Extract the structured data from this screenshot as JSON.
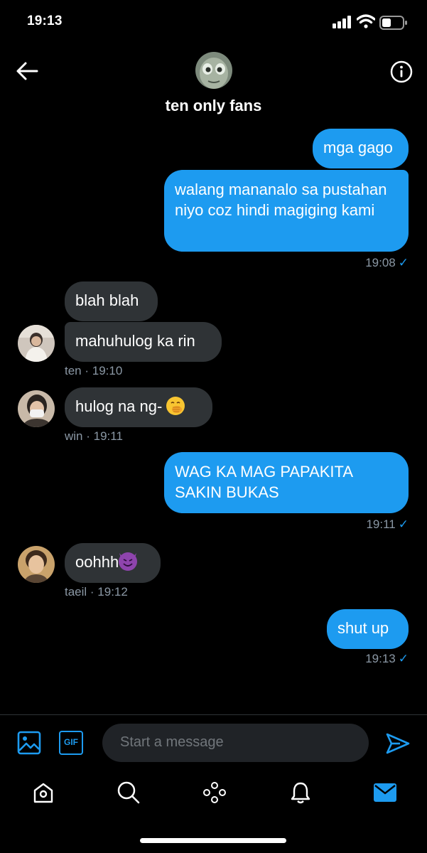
{
  "status_bar": {
    "time": "19:13"
  },
  "header": {
    "title": "ten only fans"
  },
  "messages": [
    {
      "text": "mga gago"
    },
    {
      "text": "walang mananalo sa pustahan niyo coz hindi magiging kami"
    },
    {
      "meta": "19:08"
    },
    {
      "text": "blah blah"
    },
    {
      "text": "mahuhulog ka rin"
    },
    {
      "meta": "ten · 19:10"
    },
    {
      "text": "hulog na ng-"
    },
    {
      "meta": "win · 19:11"
    },
    {
      "text": "WAG KA MAG PAPAKITA SAKIN BUKAS"
    },
    {
      "meta": "19:11"
    },
    {
      "text": "oohhh"
    },
    {
      "meta": "taeil · 19:12"
    },
    {
      "text": "shut up"
    },
    {
      "meta": "19:13"
    }
  ],
  "composer": {
    "placeholder": "Start a message",
    "gif_label": "GIF"
  },
  "colors": {
    "accent": "#1d9bf0",
    "incoming": "#2f3336",
    "background": "#000000"
  },
  "icons": [
    "signal-icon",
    "wifi-icon",
    "battery-icon",
    "back-arrow-icon",
    "info-icon",
    "image-icon",
    "gif-icon",
    "send-icon",
    "home-icon",
    "search-icon",
    "spaces-icon",
    "notifications-icon",
    "messages-icon"
  ]
}
